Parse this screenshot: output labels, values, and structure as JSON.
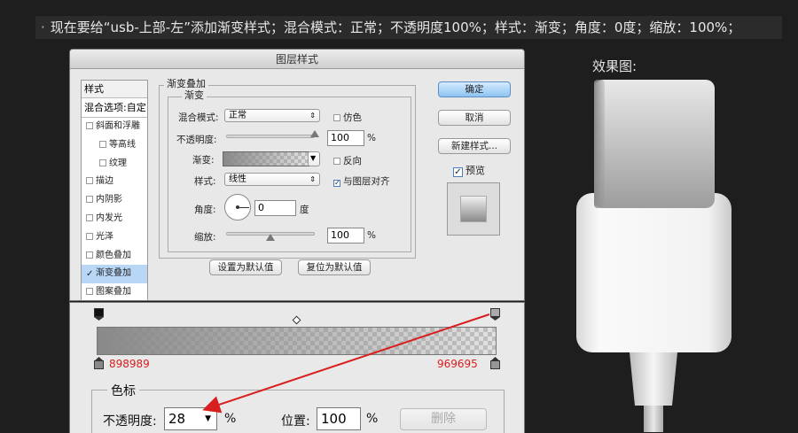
{
  "instruction": {
    "bullet": "·",
    "text": "现在要给“usb-上部-左”添加渐变样式；混合模式：正常；不透明度100%；样式：渐变；角度：0度；缩放：100%；"
  },
  "dialog": {
    "title": "图层样式",
    "sidebar": {
      "header": "样式",
      "blend_options": "混合选项:自定",
      "items": [
        {
          "label": "斜面和浮雕",
          "checked": false,
          "sub": false
        },
        {
          "label": "等高线",
          "checked": false,
          "sub": true
        },
        {
          "label": "纹理",
          "checked": false,
          "sub": true
        },
        {
          "label": "描边",
          "checked": false,
          "sub": false
        },
        {
          "label": "内阴影",
          "checked": false,
          "sub": false
        },
        {
          "label": "内发光",
          "checked": false,
          "sub": false
        },
        {
          "label": "光泽",
          "checked": false,
          "sub": false
        },
        {
          "label": "颜色叠加",
          "checked": false,
          "sub": false
        },
        {
          "label": "渐变叠加",
          "checked": true,
          "sub": false
        },
        {
          "label": "图案叠加",
          "checked": false,
          "sub": false
        }
      ]
    },
    "overlay": {
      "group_title": "渐变叠加",
      "sub_title": "渐变",
      "blend_mode_label": "混合模式:",
      "blend_mode_value": "正常",
      "dither_label": "仿色",
      "opacity_label": "不透明度:",
      "opacity_value": "100",
      "percent": "%",
      "gradient_label": "渐变:",
      "reverse_label": "反向",
      "style_label": "样式:",
      "style_value": "线性",
      "align_label": "与图层对齐",
      "angle_label": "角度:",
      "angle_value": "0",
      "degree_unit": "度",
      "scale_label": "缩放:",
      "scale_value": "100",
      "opacity_slider": 1.0,
      "scale_slider": 0.5,
      "set_default": "设置为默认值",
      "reset_default": "复位为默认值"
    },
    "buttons": {
      "ok": "确定",
      "cancel": "取消",
      "new_style": "新建样式...",
      "preview": "预览"
    }
  },
  "gradient_editor": {
    "left_color": "898989",
    "right_color": "969695",
    "left_opacity_pct": 100,
    "right_opacity_pct": 28,
    "stops_title": "色标",
    "opacity_label": "不透明度:",
    "opacity_value": "28",
    "percent": "%",
    "location_label": "位置:",
    "location_value": "100",
    "delete_label": "删除"
  },
  "effect": {
    "title": "效果图:"
  }
}
